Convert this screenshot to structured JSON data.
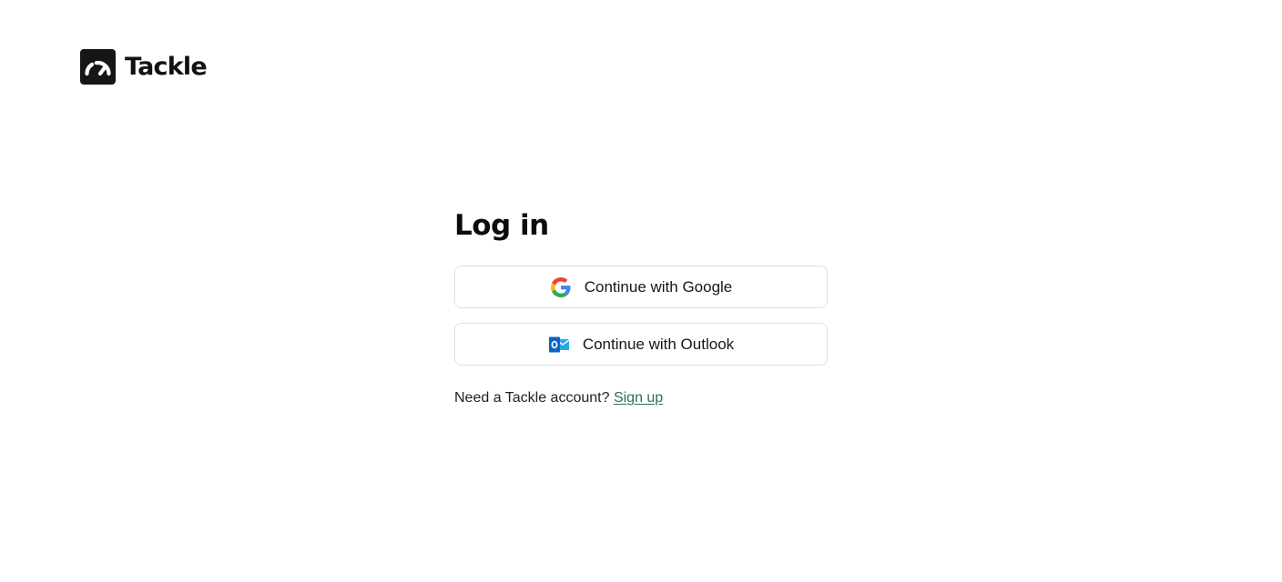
{
  "brand": {
    "name": "Tackle",
    "logo_icon": "speedometer-icon",
    "logo_color": "#161616"
  },
  "login": {
    "title": "Log in",
    "google_button": {
      "label": "Continue with Google",
      "icon": "google-icon"
    },
    "outlook_button": {
      "label": "Continue with Outlook",
      "icon": "outlook-icon",
      "icon_color": "#0a64c2"
    },
    "signup_prompt": "Need a Tackle account?",
    "signup_link": "Sign up",
    "link_color": "#2b6c66"
  }
}
